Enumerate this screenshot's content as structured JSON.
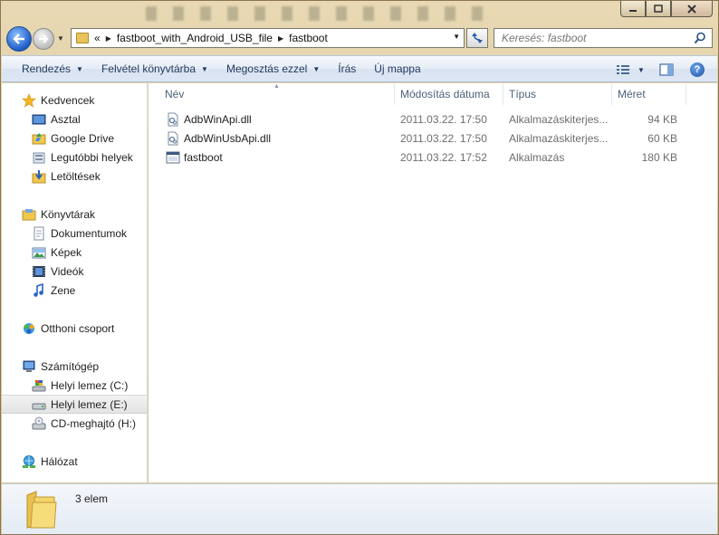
{
  "window": {
    "caption_buttons": [
      "minimize",
      "maximize",
      "close"
    ]
  },
  "address_bar": {
    "overflow_marker": "«",
    "crumbs": [
      "fastboot_with_Android_USB_file",
      "fastboot"
    ]
  },
  "search": {
    "placeholder": "Keresés: fastboot"
  },
  "toolbar": {
    "organize": "Rendezés",
    "burn": "Felvétel könyvtárba",
    "share": "Megosztás ezzel",
    "write": "Írás",
    "new_folder": "Új mappa"
  },
  "nav": {
    "favorites": "Kedvencek",
    "desktop": "Asztal",
    "google_drive": "Google Drive",
    "recent_places": "Legutóbbi helyek",
    "downloads": "Letöltések",
    "libraries": "Könyvtárak",
    "documents": "Dokumentumok",
    "pictures": "Képek",
    "videos": "Videók",
    "music": "Zene",
    "homegroup": "Otthoni csoport",
    "computer": "Számítógép",
    "drive_c": "Helyi lemez (C:)",
    "drive_e": "Helyi lemez (E:)",
    "drive_h": "CD-meghajtó (H:)",
    "network": "Hálózat"
  },
  "columns": {
    "name": "Név",
    "date": "Módosítás dátuma",
    "type": "Típus",
    "size": "Méret"
  },
  "files": [
    {
      "name": "AdbWinApi.dll",
      "date": "2011.03.22. 17:50",
      "type": "Alkalmazáskiterjes...",
      "size": "94 KB",
      "icon": "dll-icon"
    },
    {
      "name": "AdbWinUsbApi.dll",
      "date": "2011.03.22. 17:50",
      "type": "Alkalmazáskiterjes...",
      "size": "60 KB",
      "icon": "dll-icon"
    },
    {
      "name": "fastboot",
      "date": "2011.03.22. 17:52",
      "type": "Alkalmazás",
      "size": "180 KB",
      "icon": "exe-icon"
    }
  ],
  "details": {
    "item_count": "3 elem"
  },
  "colors": {
    "accent": "#1e395b",
    "frame": "#dccb9f",
    "selection": "#e4e4e4"
  }
}
